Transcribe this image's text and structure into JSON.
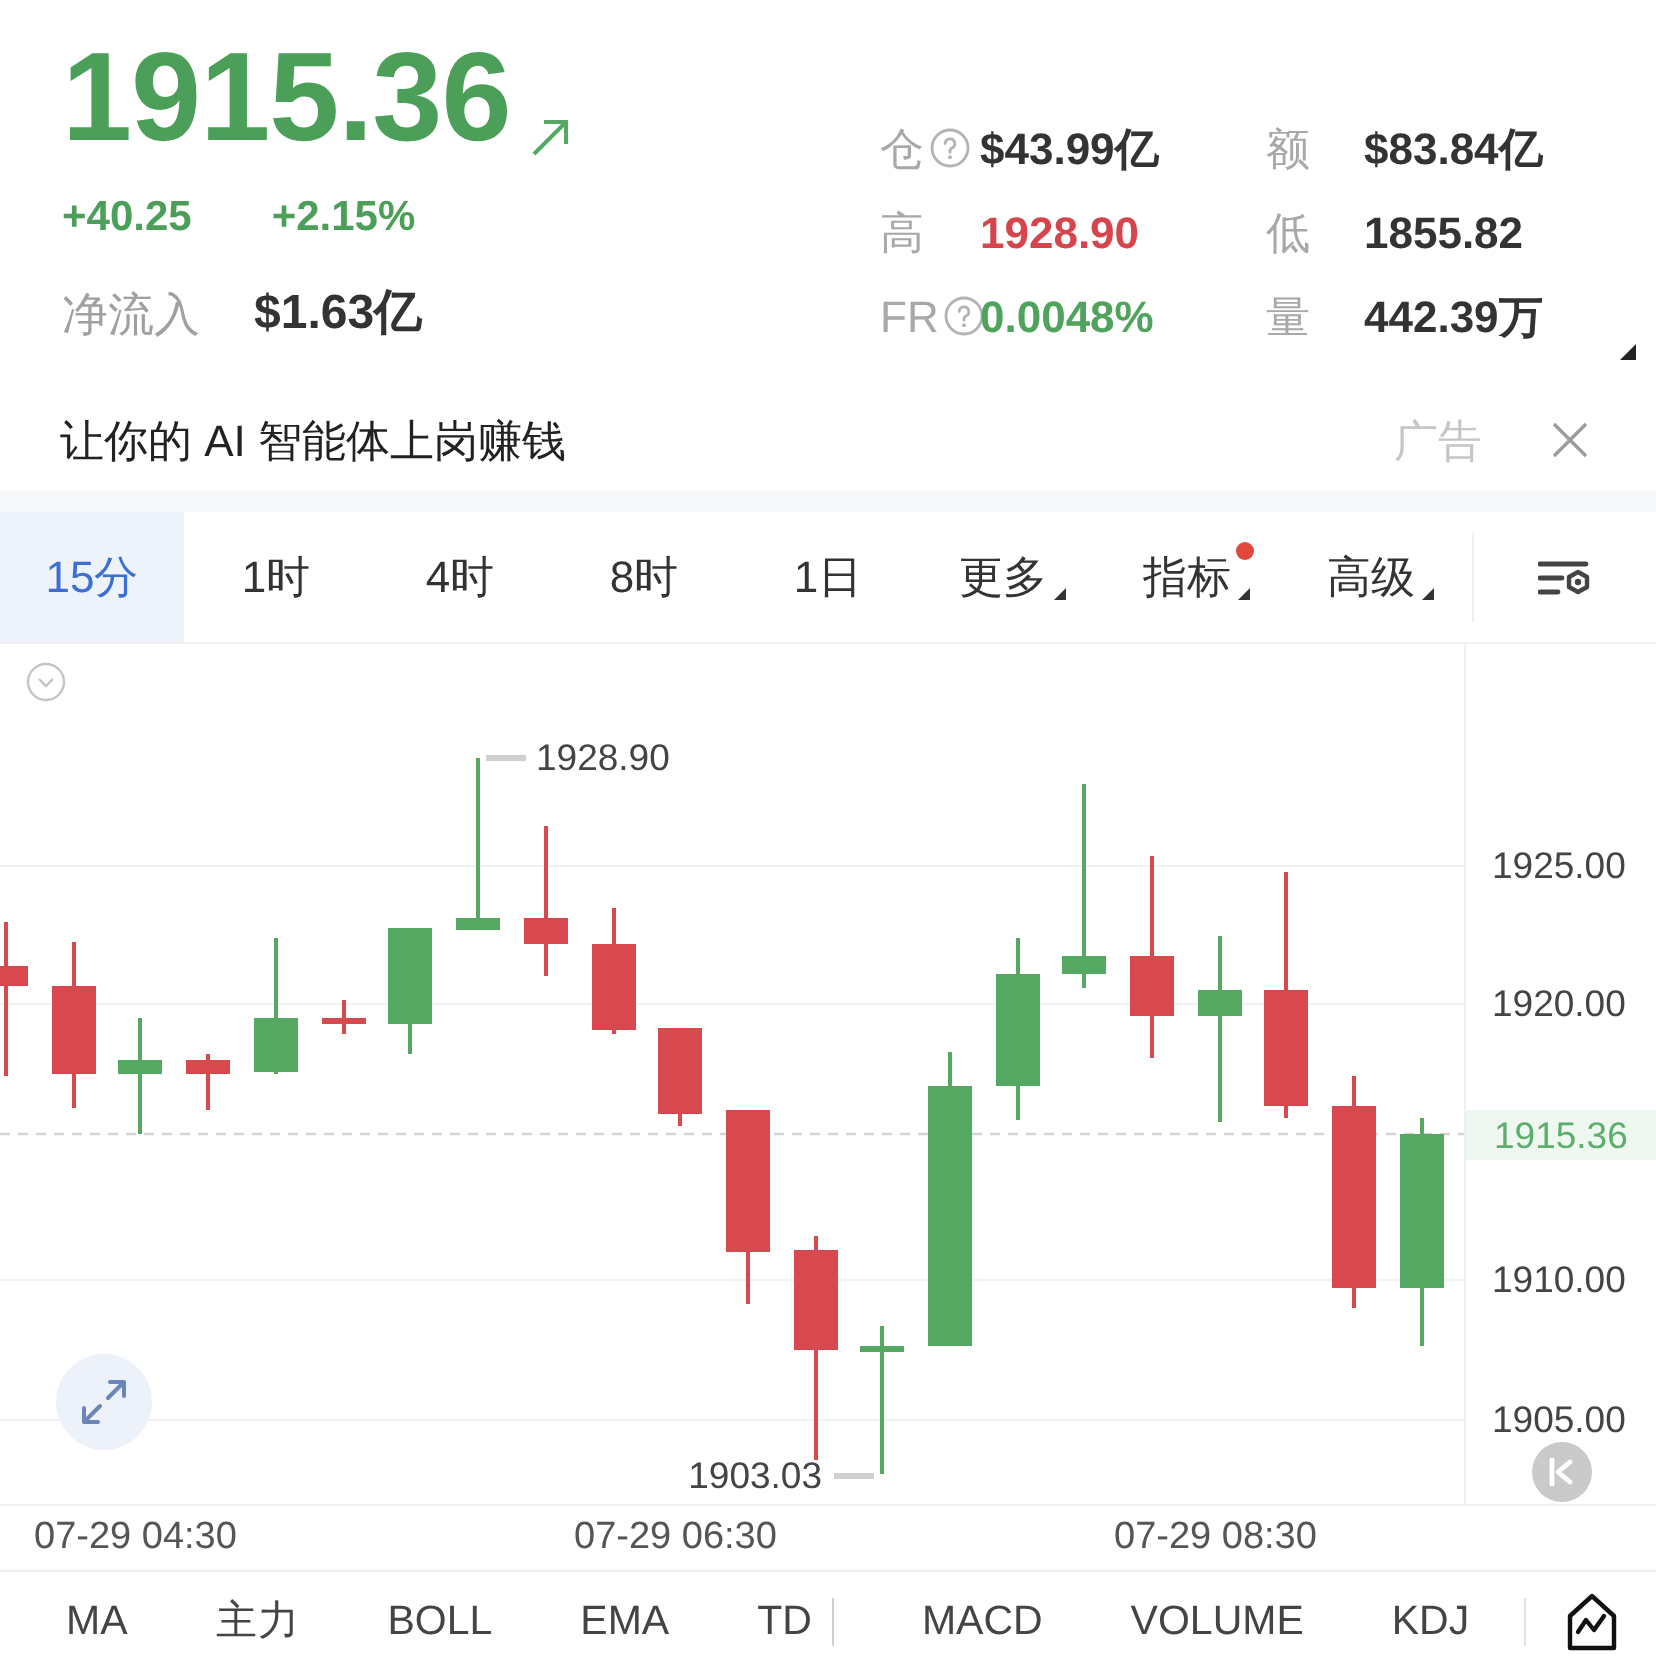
{
  "quote": {
    "price": "1915.36",
    "rising": true,
    "change": "+40.25",
    "change_percent": "+2.15%",
    "net_inflow": {
      "label": "净流入",
      "value": "$1.63亿"
    }
  },
  "stats": [
    {
      "label": "仓",
      "help": true,
      "value": "$43.99亿",
      "color": "#333333"
    },
    {
      "label": "额",
      "help": false,
      "value": "$83.84亿",
      "color": "#333333"
    },
    {
      "label": "高",
      "help": false,
      "value": "1928.90",
      "color": "#d6454c"
    },
    {
      "label": "低",
      "help": false,
      "value": "1855.82",
      "color": "#333333"
    },
    {
      "label": "FR",
      "help": true,
      "value": "0.0048%",
      "color": "#4fa35c"
    },
    {
      "label": "量",
      "help": false,
      "value": "442.39万",
      "color": "#333333"
    }
  ],
  "ad": {
    "text": "让你的 AI 智能体上岗赚钱",
    "tag": "广告"
  },
  "tabs": [
    {
      "label": "15分",
      "selected": true,
      "dropdown": false,
      "dot": false
    },
    {
      "label": "1时",
      "selected": false,
      "dropdown": false,
      "dot": false
    },
    {
      "label": "4时",
      "selected": false,
      "dropdown": false,
      "dot": false
    },
    {
      "label": "8时",
      "selected": false,
      "dropdown": false,
      "dot": false
    },
    {
      "label": "1日",
      "selected": false,
      "dropdown": false,
      "dot": false
    },
    {
      "label": "更多",
      "selected": false,
      "dropdown": true,
      "dot": false
    },
    {
      "label": "指标",
      "selected": false,
      "dropdown": true,
      "dot": true
    },
    {
      "label": "高级",
      "selected": false,
      "dropdown": true,
      "dot": false
    }
  ],
  "chart": {
    "price_axis": [
      "1925.00",
      "1920.00",
      "1910.00",
      "1905.00"
    ],
    "last_price": "1915.36",
    "high_label": "1928.90",
    "low_label": "1903.03",
    "time_axis": [
      "07-29 04:30",
      "07-29 06:30",
      "07-29 08:30"
    ]
  },
  "indicators": {
    "main": [
      "MA",
      "主力",
      "BOLL",
      "EMA",
      "TD"
    ],
    "sub": [
      "MACD",
      "VOLUME",
      "KDJ"
    ]
  }
}
